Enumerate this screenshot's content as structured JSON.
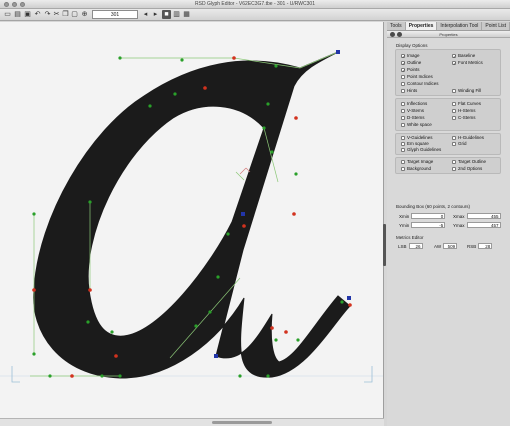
{
  "window": {
    "title": "RSD Glyph Editor - V62EC3G7.tbe - 301 - U/RWC301"
  },
  "toolbar": {
    "glyph_number": "301",
    "icons": [
      "new-icon",
      "open-icon",
      "save-icon",
      "undo-icon",
      "redo-icon",
      "cut-icon",
      "copy-icon",
      "paste-icon",
      "zoom-icon",
      "nav-back-icon",
      "nav-forward-icon",
      "view-single-icon",
      "view-split-icon",
      "view-grid-icon"
    ]
  },
  "tabs": [
    "Tools",
    "Properties",
    "Interpolation Tool",
    "Point List"
  ],
  "active_tab": "Properties",
  "panel": {
    "header": "Properties",
    "display_options_title": "Display Options",
    "options": {
      "image": {
        "label": "Image",
        "checked": true
      },
      "baseline": {
        "label": "Baseline",
        "checked": true
      },
      "outline": {
        "label": "Outline",
        "checked": true
      },
      "font_metrics": {
        "label": "Font Metrics",
        "checked": true
      },
      "points": {
        "label": "Points",
        "checked": true
      },
      "point_indices": {
        "label": "Point Indices",
        "checked": false
      },
      "contour_indices": {
        "label": "Contour Indices",
        "checked": false
      },
      "hints": {
        "label": "Hints",
        "checked": false
      },
      "winding_fill": {
        "label": "Winding Fill",
        "checked": false
      },
      "inflections": {
        "label": "Inflections",
        "checked": false
      },
      "flat_curves": {
        "label": "Flat Curves",
        "checked": false
      },
      "v_stems": {
        "label": "V-Stems",
        "checked": false
      },
      "h_stems": {
        "label": "H-Stems",
        "checked": false
      },
      "d_stems": {
        "label": "D-Stems",
        "checked": false
      },
      "c_stems": {
        "label": "C-Stems",
        "checked": false
      },
      "white_space": {
        "label": "White space",
        "checked": false
      },
      "v_guidelines": {
        "label": "V-Guidelines",
        "checked": false
      },
      "h_guidelines": {
        "label": "H-Guidelines",
        "checked": false
      },
      "em_square": {
        "label": "Em square",
        "checked": false
      },
      "grid": {
        "label": "Grid",
        "checked": false
      },
      "glyph_guidelines": {
        "label": "Glyph Guidelines",
        "checked": false
      },
      "target_image": {
        "label": "Target Image",
        "checked": false
      },
      "target_outline": {
        "label": "Target Outline",
        "checked": false
      },
      "background": {
        "label": "Background",
        "checked": false
      },
      "second_options": {
        "label": "2nd Options",
        "checked": false
      }
    },
    "bounding_box": {
      "title": "Bounding Box (60 points, 2 contours)",
      "xmin_label": "Xmin",
      "xmin": "0",
      "xmax_label": "Xmax",
      "xmax": "455",
      "ymin_label": "Ymin",
      "ymin": "-5",
      "ymax_label": "Ymax",
      "ymax": "457"
    },
    "metrics": {
      "title": "Metrics Editor",
      "lsb_label": "LSB",
      "lsb": "26",
      "aw_label": "AW",
      "aw": "509",
      "rsb_label": "RSB",
      "rsb": "28"
    }
  },
  "colors": {
    "glyph_fill": "#1b1b1b",
    "on_curve_point": "#2aa02a",
    "corner_point": "#d2321e",
    "end_point": "#2235a8",
    "guide": "#8cc878"
  }
}
